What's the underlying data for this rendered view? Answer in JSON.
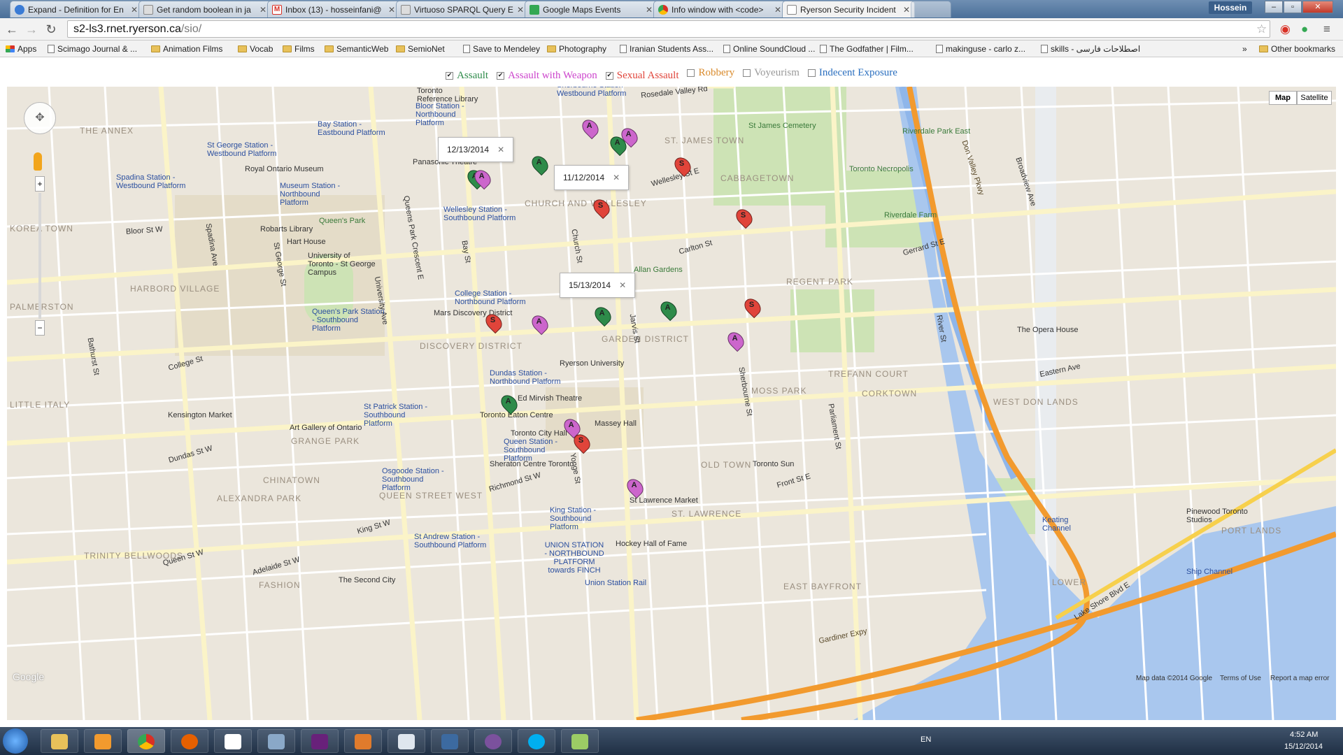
{
  "browser": {
    "tabs": [
      {
        "title": "Expand - Definition for En",
        "favicon_color": "#3a7bd5"
      },
      {
        "title": "Get random boolean in ja",
        "favicon_color": "#777777"
      },
      {
        "title": "Inbox (13) - hosseinfani@",
        "favicon_color": "#d93025"
      },
      {
        "title": "Virtuoso SPARQL Query E",
        "favicon_color": "#777777"
      },
      {
        "title": "Google Maps Events",
        "favicon_color": "#34a853"
      },
      {
        "title": "Info window with <code>",
        "favicon_color": "#4285f4"
      },
      {
        "title": "Ryerson Security Incident",
        "favicon_color": "#ffffff"
      }
    ],
    "user": "Hossein",
    "url_host": "s2-ls3.rnet.ryerson.ca",
    "url_path": "/sio/",
    "bookmarks": [
      {
        "label": "Apps",
        "kind": "apps"
      },
      {
        "label": "Scimago Journal & ...",
        "kind": "page"
      },
      {
        "label": "Animation Films",
        "kind": "folder"
      },
      {
        "label": "Vocab",
        "kind": "folder"
      },
      {
        "label": "Films",
        "kind": "folder"
      },
      {
        "label": "SemanticWeb",
        "kind": "folder"
      },
      {
        "label": "SemioNet",
        "kind": "folder"
      },
      {
        "label": "Save to Mendeley",
        "kind": "page"
      },
      {
        "label": "Photography",
        "kind": "folder"
      },
      {
        "label": "Iranian Students Ass...",
        "kind": "page"
      },
      {
        "label": "Online SoundCloud ...",
        "kind": "page"
      },
      {
        "label": "The Godfather | Film...",
        "kind": "page"
      },
      {
        "label": "makinguse - carlo z...",
        "kind": "page"
      },
      {
        "label": "skills - اصطلاحات فارسی",
        "kind": "page"
      }
    ],
    "more_bookmarks": "»",
    "other_bookmarks": "Other bookmarks"
  },
  "filters": [
    {
      "label": "Assault",
      "checked": true,
      "color": "#2e8b4a"
    },
    {
      "label": "Assault with Weapon",
      "checked": true,
      "color": "#cc44cc"
    },
    {
      "label": "Sexual Assault",
      "checked": true,
      "color": "#e0443a"
    },
    {
      "label": "Robbery",
      "checked": false,
      "color": "#d98a2b"
    },
    {
      "label": "Voyeurism",
      "checked": false,
      "color": "#999999"
    },
    {
      "label": "Indecent Exposure",
      "checked": false,
      "color": "#2b6fbf"
    }
  ],
  "map": {
    "type_buttons": [
      "Map",
      "Satellite"
    ],
    "markers": [
      {
        "letter": "A",
        "kind": "AW"
      },
      {
        "letter": "A",
        "kind": "AW"
      },
      {
        "letter": "A",
        "kind": "A"
      },
      {
        "letter": "A",
        "kind": "A"
      },
      {
        "letter": "A",
        "kind": "A"
      },
      {
        "letter": "A",
        "kind": "AW"
      },
      {
        "letter": "S",
        "kind": "S"
      },
      {
        "letter": "S",
        "kind": "S"
      },
      {
        "letter": "S",
        "kind": "S"
      },
      {
        "letter": "A",
        "kind": "A"
      },
      {
        "letter": "A",
        "kind": "A"
      },
      {
        "letter": "S",
        "kind": "S"
      },
      {
        "letter": "S",
        "kind": "S"
      },
      {
        "letter": "A",
        "kind": "AW"
      },
      {
        "letter": "A",
        "kind": "AW"
      },
      {
        "letter": "A",
        "kind": "A"
      },
      {
        "letter": "A",
        "kind": "AW"
      },
      {
        "letter": "S",
        "kind": "S"
      },
      {
        "letter": "A",
        "kind": "AW"
      }
    ],
    "info_windows": [
      "12/13/2014",
      "11/12/2014",
      "15/13/2014"
    ],
    "labels": {
      "annex": "THE ANNEX",
      "harbord_village": "HARBORD VILLAGE",
      "palmerston": "PALMERSTON",
      "little_italy": "LITTLE ITALY",
      "grange_park": "GRANGE PARK",
      "chinatown": "CHINATOWN",
      "alexandra_park": "ALEXANDRA PARK",
      "queen_street_west": "QUEEN STREET WEST",
      "trinity_bellwoods": "TRINITY BELLWOODS",
      "fashion": "FASHION",
      "korea_town": "KOREA TOWN",
      "discovery_district": "DISCOVERY DISTRICT",
      "church_wellesley": "CHURCH AND WELLESLEY",
      "garden_district": "GARDEN DISTRICT",
      "st_james_town": "ST. JAMES TOWN",
      "cabbagetown": "CABBAGETOWN",
      "regent_park": "REGENT PARK",
      "moss_park": "MOSS PARK",
      "corktown": "CORKTOWN",
      "trefann_court": "TREFANN COURT",
      "west_don_lands": "WEST DON LANDS",
      "old_town": "OLD TOWN",
      "st_lawrence": "ST. LAWRENCE",
      "port_lands": "PORT LANDS",
      "lower": "LOWER",
      "east_bayfront": "EAST BAYFRONT",
      "ryerson": "Ryerson University",
      "uoft": "University of Toronto - St George Campus",
      "rom": "Royal Ontario Museum",
      "ago": "Art Gallery of Ontario",
      "eaton": "Toronto Eaton Centre",
      "city_hall": "Toronto City Hall",
      "massey": "Massey Hall",
      "mirvish": "Ed Mirvish Theatre",
      "mars": "Mars Discovery District",
      "allan": "Allan Gardens",
      "st_james_cem": "St James Cemetery",
      "necropolis": "Toronto Necropolis",
      "riverdale_farm": "Riverdale Farm",
      "riverdale_east": "Riverdale Park East",
      "opera": "The Opera House",
      "queens_park": "Queen's Park",
      "robarts": "Robarts Library",
      "hart": "Hart House",
      "st_lawrence_market": "St Lawrence Market",
      "hockey": "Hockey Hall of Fame",
      "sheraton": "Sheraton Centre Toronto",
      "toronto_sun": "Toronto Sun",
      "pinewood": "Pinewood Toronto Studios",
      "keating": "Keating Channel",
      "ship_channel": "Ship Channel",
      "kensington": "Kensington Market",
      "panasonic": "Panasonic Theatre",
      "reference_library": "Toronto Reference Library",
      "union_station_rail": "Union Station Rail",
      "second_city": "The Second City",
      "don_valley_pkwy": "Don Valley Pkwy",
      "gardiner": "Gardiner Expy",
      "lakeshore": "Lake Shore Blvd E",
      "bloor": "Bloor St W",
      "college": "College St",
      "dundas": "Dundas St W",
      "queen": "Queen St W",
      "king": "King St W",
      "richmond": "Richmond St W",
      "adelaide": "Adelaide St W",
      "gerrard": "Gerrard St E",
      "carlton": "Carlton St",
      "wellesley": "Wellesley St E",
      "yonge": "Yonge St",
      "jarvis": "Jarvis St",
      "church": "Church St",
      "bay": "Bay St",
      "spadina": "Spadina Ave",
      "parliament": "Parliament St",
      "sherbourne": "Sherbourne St",
      "river": "River St",
      "broadview": "Broadview Ave",
      "st_george": "St George St",
      "university": "University Ave",
      "bathurst": "Bathurst St",
      "queens_park_cres": "Queens Park Crescent E",
      "rosedale": "Rosedale Valley Rd",
      "eastern": "Eastern Ave",
      "front": "Front St E",
      "station_sherbourne": "Sherbourne Station - Westbound Platform",
      "station_bloor": "Bloor Station - Northbound Platform",
      "station_bay": "Bay Station - Eastbound Platform",
      "station_stgeorge": "St George Station - Westbound Platform",
      "station_spadina": "Spadina Station - Westbound Platform",
      "station_museum": "Museum Station - Northbound Platform",
      "station_wellesley": "Wellesley Station - Southbound Platform",
      "station_college": "College Station - Northbound Platform",
      "station_queenspark": "Queen's Park Station - Southbound Platform",
      "station_dundas": "Dundas Station - Northbound Platform",
      "station_stpatrick": "St Patrick Station - Southbound Platform",
      "station_queen": "Queen Station - Southbound Platform",
      "station_osgoode": "Osgoode Station - Southbound Platform",
      "station_king": "King Station - Southbound Platform",
      "station_standrew": "St Andrew Station - Southbound Platform",
      "station_union": "UNION STATION - NORTHBOUND PLATFORM towards FINCH"
    },
    "footer": {
      "data": "Map data ©2014 Google",
      "terms": "Terms of Use",
      "report": "Report a map error",
      "logo": "Google"
    }
  },
  "taskbar": {
    "lang": "EN",
    "time": "4:52 AM",
    "date": "15/12/2014"
  }
}
